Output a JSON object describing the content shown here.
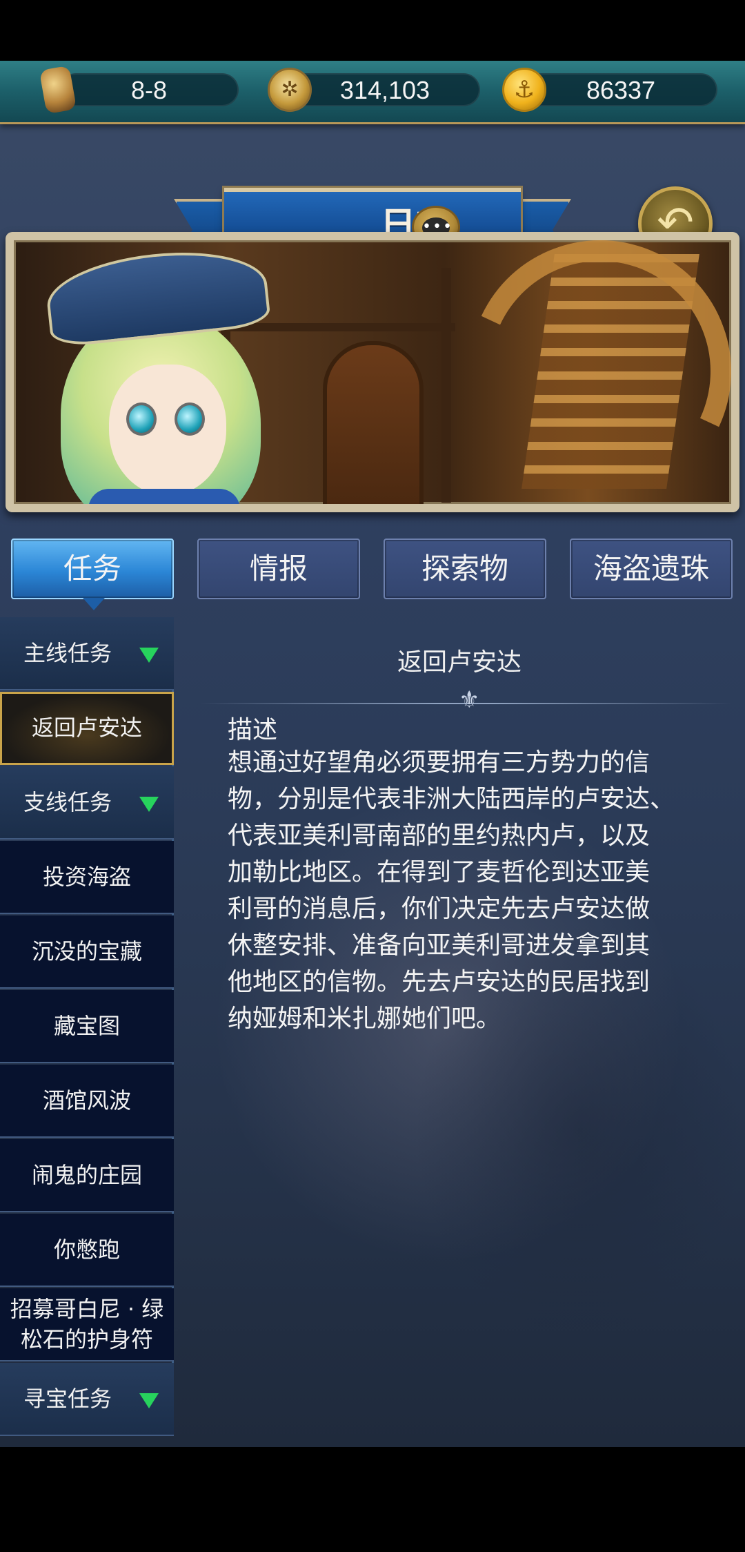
{
  "resources": {
    "stage": "8-8",
    "compass_value": "314,103",
    "gold_value": "86337"
  },
  "header": {
    "title": "日志"
  },
  "tabs": [
    {
      "label": "任务",
      "active": true
    },
    {
      "label": "情报",
      "active": false
    },
    {
      "label": "探索物",
      "active": false
    },
    {
      "label": "海盗遗珠",
      "active": false
    }
  ],
  "sidebar": {
    "items": [
      {
        "label": "主线任务",
        "type": "category"
      },
      {
        "label": "返回卢安达",
        "type": "selected"
      },
      {
        "label": "支线任务",
        "type": "category"
      },
      {
        "label": "投资海盗",
        "type": "sub"
      },
      {
        "label": "沉没的宝藏",
        "type": "sub"
      },
      {
        "label": "藏宝图",
        "type": "sub"
      },
      {
        "label": "酒馆风波",
        "type": "sub"
      },
      {
        "label": "闹鬼的庄园",
        "type": "sub"
      },
      {
        "label": "你憋跑",
        "type": "sub"
      },
      {
        "label_line1": "招募哥白尼 · 绿",
        "label_line2": "松石的护身符",
        "type": "sub"
      },
      {
        "label": "寻宝任务",
        "type": "category"
      }
    ]
  },
  "content": {
    "quest_title": "返回卢安达",
    "desc_label": "描述",
    "desc_lines": [
      "想通过好望角必须要拥有三方势力的信",
      "物，分别是代表非洲大陆西岸的卢安达、",
      "代表亚美利哥南部的里约热内卢，以及",
      "加勒比地区。在得到了麦哲伦到达亚美",
      "利哥的消息后，你们决定先去卢安达做",
      "休整安排、准备向亚美利哥进发拿到其",
      "他地区的信物。先去卢安达的民居找到",
      "纳娅姆和米扎娜她们吧。"
    ]
  },
  "colors": {
    "accent_tab": "#2b86d6",
    "category_arrow": "#27d35d",
    "selected_border": "#c9a44a"
  }
}
